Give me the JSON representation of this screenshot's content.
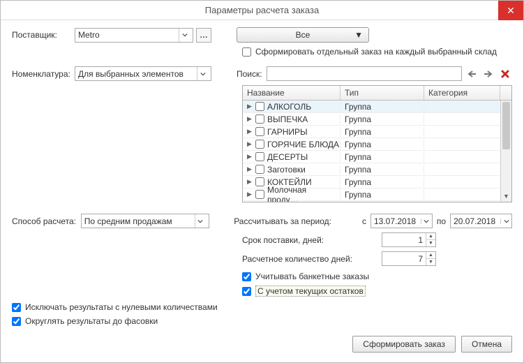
{
  "window": {
    "title": "Параметры расчета заказа"
  },
  "labels": {
    "supplier": "Поставщик:",
    "nomenclature": "Номенклатура:",
    "search": "Поиск:",
    "calc_method": "Способ расчета:",
    "period": "Рассчитывать за период:",
    "from": "с",
    "to": "по",
    "delivery_days": "Срок поставки, дней:",
    "calc_days": "Расчетное количество дней:"
  },
  "supplier": {
    "value": "Metro"
  },
  "warehouse_dd": {
    "value": "Все"
  },
  "separate_order_chk": {
    "label": "Сформировать отдельный заказ на каждый выбранный склад",
    "checked": false
  },
  "nomenclature_dd": {
    "value": "Для выбранных элементов"
  },
  "search": {
    "value": ""
  },
  "table": {
    "headers": {
      "name": "Название",
      "type": "Тип",
      "category": "Категория"
    },
    "rows": [
      {
        "name": "АЛКОГОЛЬ",
        "type": "Группа",
        "selected": true
      },
      {
        "name": "ВЫПЕЧКА",
        "type": "Группа"
      },
      {
        "name": "ГАРНИРЫ",
        "type": "Группа"
      },
      {
        "name": "ГОРЯЧИЕ БЛЮДА",
        "type": "Группа"
      },
      {
        "name": "ДЕСЕРТЫ",
        "type": "Группа"
      },
      {
        "name": "Заготовки",
        "type": "Группа"
      },
      {
        "name": "КОКТЕЙЛИ",
        "type": "Группа"
      },
      {
        "name": "Молочная проду…",
        "type": "Группа"
      }
    ]
  },
  "calc_method": {
    "value": "По средним продажам"
  },
  "period_from": "13.07.2018",
  "period_to": "20.07.2018",
  "delivery_days": "1",
  "calc_days": "7",
  "banquet_chk": {
    "label": "Учитывать банкетные заказы",
    "checked": true
  },
  "stock_chk": {
    "label": "С учетом текущих остатков",
    "checked": true
  },
  "exclude_zero_chk": {
    "label": "Исключать результаты с нулевыми количествами",
    "checked": true
  },
  "round_chk": {
    "label": "Округлять результаты до фасовки",
    "checked": true
  },
  "buttons": {
    "submit": "Сформировать заказ",
    "cancel": "Отмена"
  }
}
